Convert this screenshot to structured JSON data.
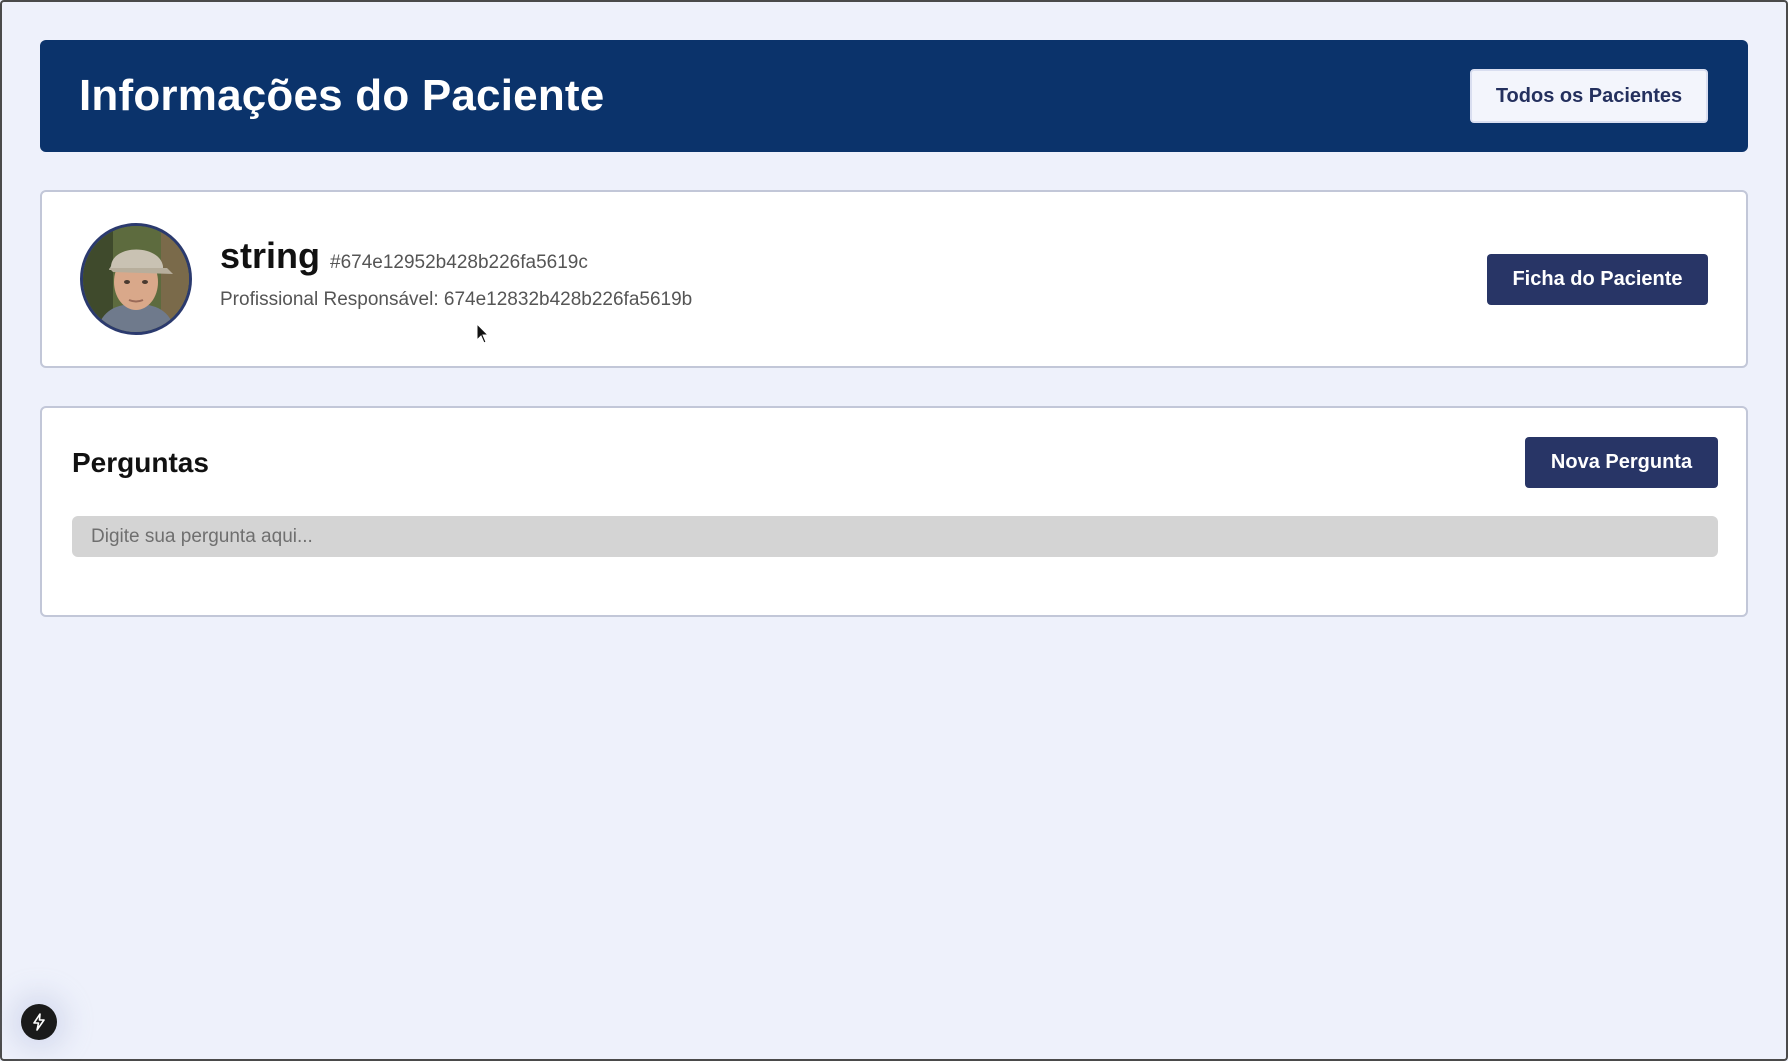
{
  "header": {
    "title": "Informações do Paciente",
    "all_patients_label": "Todos os Pacientes"
  },
  "patient": {
    "name": "string",
    "id": "#674e12952b428b226fa5619c",
    "professional_label": "Profissional Responsável:",
    "professional_id": "674e12832b428b226fa5619b",
    "record_button_label": "Ficha do Paciente"
  },
  "questions": {
    "title": "Perguntas",
    "new_question_label": "Nova Pergunta",
    "input_placeholder": "Digite sua pergunta aqui...",
    "input_value": ""
  },
  "icons": {
    "fab": "lightning-bolt-icon",
    "cursor": "mouse-pointer-icon"
  },
  "colors": {
    "header_bg": "#0b336b",
    "page_bg": "#eef1fb",
    "primary_button": "#283566"
  }
}
